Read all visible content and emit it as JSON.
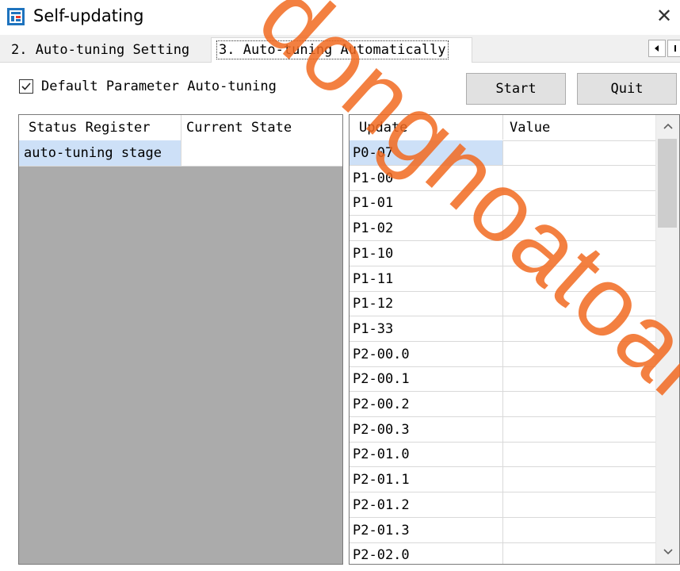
{
  "window": {
    "title": "Self-updating",
    "icon": "app-icon",
    "close_icon": "close-icon"
  },
  "tabs": [
    {
      "label": "2. Auto-tuning Setting",
      "active": false
    },
    {
      "label": "3. Auto-tuning Automatically",
      "active": true
    }
  ],
  "options": {
    "default_autotune_label": "Default Parameter Auto-tuning",
    "default_autotune_checked": true
  },
  "buttons": {
    "start_label": "Start",
    "quit_label": "Quit"
  },
  "status_table": {
    "headers": [
      "Status Register",
      "Current State"
    ],
    "rows": [
      {
        "register": "auto-tuning stage",
        "state": ""
      }
    ]
  },
  "update_table": {
    "headers": [
      "Update",
      "Value"
    ],
    "rows": [
      {
        "update": "P0-07",
        "value": ""
      },
      {
        "update": "P1-00",
        "value": ""
      },
      {
        "update": "P1-01",
        "value": ""
      },
      {
        "update": "P1-02",
        "value": ""
      },
      {
        "update": "P1-10",
        "value": ""
      },
      {
        "update": "P1-11",
        "value": ""
      },
      {
        "update": "P1-12",
        "value": ""
      },
      {
        "update": "P1-33",
        "value": ""
      },
      {
        "update": "P2-00.0",
        "value": ""
      },
      {
        "update": "P2-00.1",
        "value": ""
      },
      {
        "update": "P2-00.2",
        "value": ""
      },
      {
        "update": "P2-00.3",
        "value": ""
      },
      {
        "update": "P2-01.0",
        "value": ""
      },
      {
        "update": "P2-01.1",
        "value": ""
      },
      {
        "update": "P2-01.2",
        "value": ""
      },
      {
        "update": "P2-01.3",
        "value": ""
      },
      {
        "update": "P2-02.0",
        "value": ""
      }
    ],
    "selected_index": 0
  },
  "watermark": {
    "text": "dongnoatoan",
    "color": "#f26a21"
  },
  "colors": {
    "selection": "#cde0f7",
    "empty_panel": "#ababab"
  }
}
